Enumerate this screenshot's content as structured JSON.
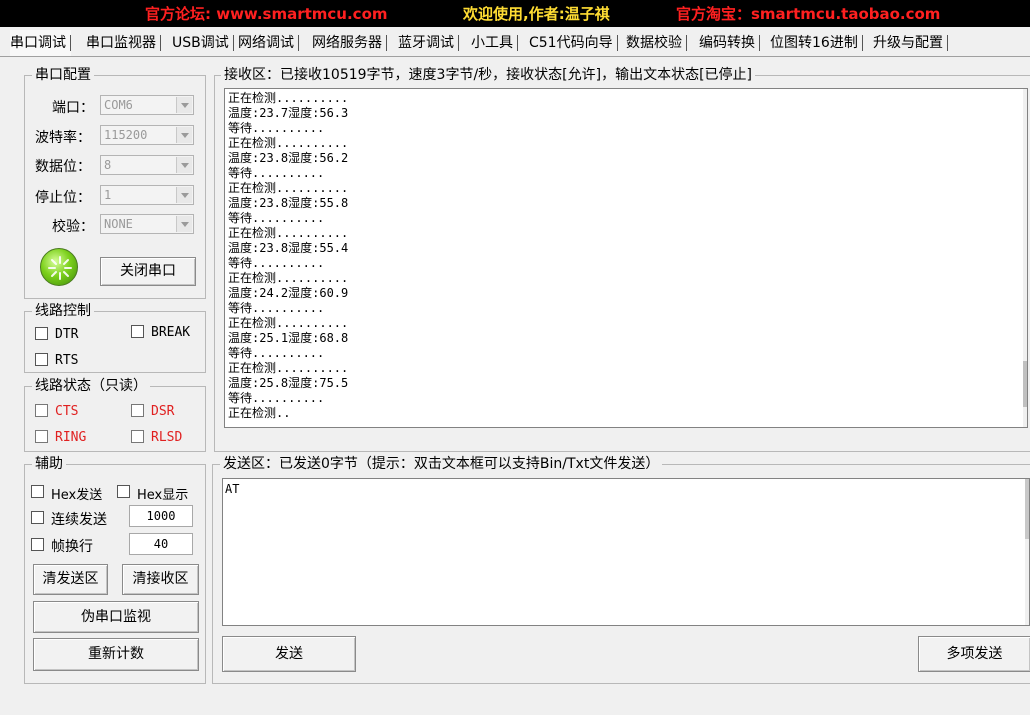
{
  "banner": {
    "forum": "官方论坛: www.smartmcu.com",
    "welcome": "欢迎使用,作者:温子祺",
    "shop": "官方淘宝：smartmcu.taobao.com"
  },
  "tabs": [
    "串口调试",
    "串口监视器",
    "USB调试",
    "网络调试",
    "网络服务器",
    "蓝牙调试",
    "小工具",
    "C51代码向导",
    "数据校验",
    "编码转换",
    "位图转16进制",
    "升级与配置"
  ],
  "serial_config": {
    "title": "串口配置",
    "port_label": "端口：",
    "port_value": "COM6",
    "baud_label": "波特率：",
    "baud_value": "115200",
    "databits_label": "数据位：",
    "databits_value": "8",
    "stopbits_label": "停止位：",
    "stopbits_value": "1",
    "parity_label": "校验：",
    "parity_value": "NONE",
    "close_button": "关闭串口"
  },
  "line_control": {
    "title": "线路控制",
    "dtr": "DTR",
    "break": "BREAK",
    "rts": "RTS"
  },
  "line_status": {
    "title": "线路状态（只读）",
    "cts": "CTS",
    "dsr": "DSR",
    "ring": "RING",
    "rlsd": "RLSD"
  },
  "aux": {
    "title": "辅助",
    "hex_send": "Hex发送",
    "hex_display": "Hex显示",
    "continuous_send": "连续发送",
    "continuous_value": "1000",
    "frame_newline": "帧换行",
    "frame_value": "40",
    "clear_send": "清发送区",
    "clear_recv": "清接收区",
    "fake_monitor": "伪串口监视",
    "recount": "重新计数"
  },
  "receive": {
    "title": "接收区：已接收10519字节，速度3字节/秒，接收状态[允许]，输出文本状态[已停止]",
    "text": "正在检测..........\n温度:23.7湿度:56.3\n等待..........\n正在检测..........\n温度:23.8湿度:56.2\n等待..........\n正在检测..........\n温度:23.8湿度:55.8\n等待..........\n正在检测..........\n温度:23.8湿度:55.4\n等待..........\n正在检测..........\n温度:24.2湿度:60.9\n等待..........\n正在检测..........\n温度:25.1湿度:68.8\n等待..........\n正在检测..........\n温度:25.8湿度:75.5\n等待..........\n正在检测.."
  },
  "send": {
    "title": "发送区：已发送0字节（提示：双击文本框可以支持Bin/Txt文件发送）",
    "text": "AT",
    "send_button": "发送",
    "multi_send_button": "多项发送"
  },
  "colors": {
    "banner_bg": "#000000",
    "banner_red": "#ff2020",
    "banner_yellow": "#ffdd33",
    "status_red": "#e02020"
  }
}
